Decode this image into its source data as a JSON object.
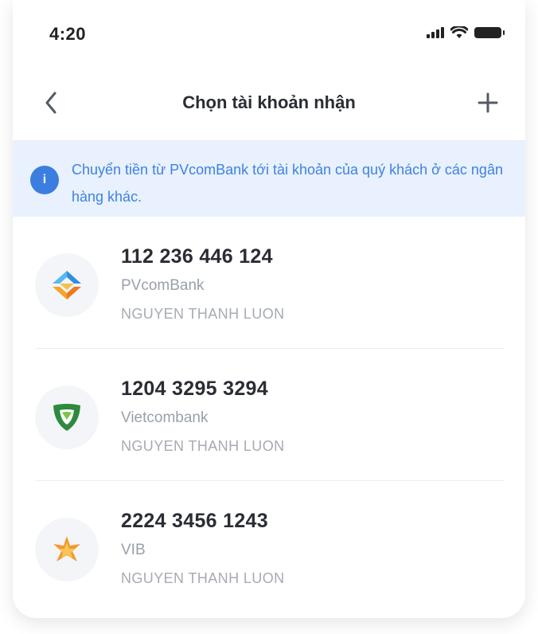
{
  "status_bar": {
    "time": "4:20"
  },
  "header": {
    "title": "Chọn tài khoản nhận",
    "back_icon": "chevron-left-icon",
    "add_icon": "plus-icon"
  },
  "banner": {
    "icon": "info-icon",
    "text": "Chuyển tiền từ PVcomBank tới tài khoản của quý khách ở các ngân hàng khác."
  },
  "accounts": [
    {
      "number": "112 236 446 124",
      "bank": "PVcomBank",
      "holder": "NGUYEN THANH LUON",
      "logo_icon": "pvcombank-logo-icon"
    },
    {
      "number": "1204 3295 3294",
      "bank": "Vietcombank",
      "holder": "NGUYEN THANH LUON",
      "logo_icon": "vietcombank-logo-icon"
    },
    {
      "number": "2224 3456 1243",
      "bank": "VIB",
      "holder": "NGUYEN THANH LUON",
      "logo_icon": "vib-logo-icon"
    }
  ],
  "colors": {
    "accent": "#3b7ee0",
    "banner_bg": "#e8f1fd",
    "title_text": "#2a2d34",
    "secondary_text": "#9aa0aa"
  }
}
